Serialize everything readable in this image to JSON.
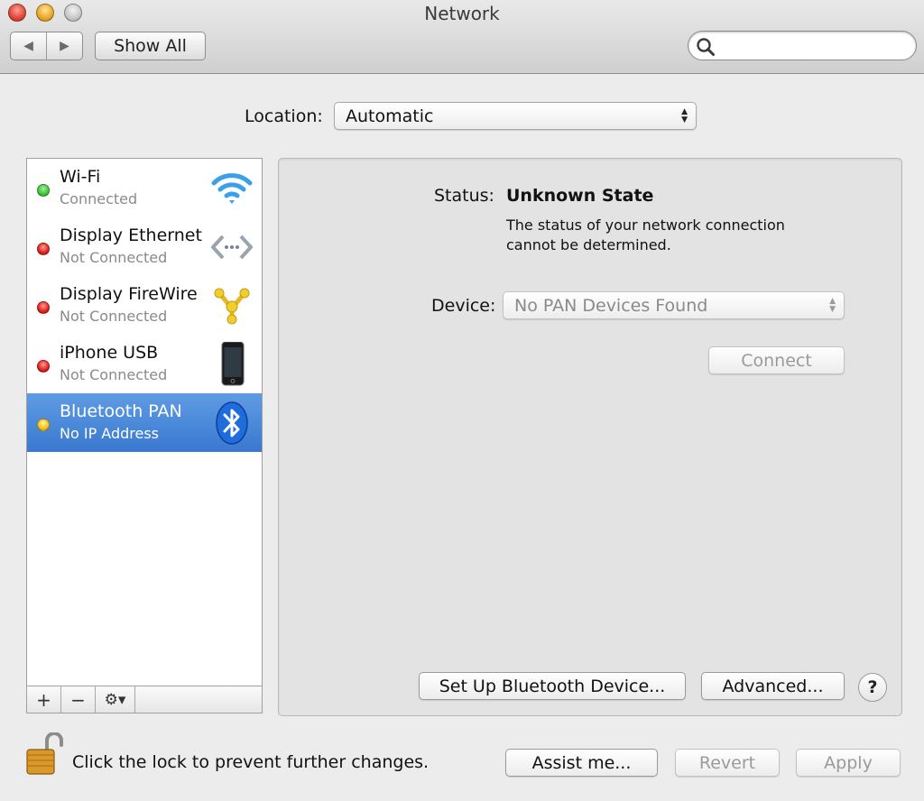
{
  "window": {
    "title": "Network"
  },
  "toolbar": {
    "back_glyph": "◀",
    "forward_glyph": "▶",
    "show_all_label": "Show All",
    "search_placeholder": "",
    "search_value": ""
  },
  "location": {
    "label": "Location:",
    "value": "Automatic"
  },
  "services": [
    {
      "name": "Wi-Fi",
      "status": "Connected",
      "status_color": "#3fc43a",
      "icon": "wifi-icon"
    },
    {
      "name": "Display Ethernet",
      "status": "Not Connected",
      "status_color": "#e0231c",
      "icon": "ethernet-icon"
    },
    {
      "name": "Display FireWire",
      "status": "Not Connected",
      "status_color": "#e0231c",
      "icon": "firewire-icon"
    },
    {
      "name": "iPhone USB",
      "status": "Not Connected",
      "status_color": "#e0231c",
      "icon": "iphone-icon"
    },
    {
      "name": "Bluetooth PAN",
      "status": "No IP Address",
      "status_color": "#f2c21b",
      "icon": "bluetooth-icon",
      "selected": true
    }
  ],
  "list_toolbar": {
    "add_label": "+",
    "remove_label": "−",
    "action_label": "⚙▾"
  },
  "detail": {
    "status_label": "Status:",
    "status_value": "Unknown State",
    "status_description": "The status of your network connection cannot be determined.",
    "device_label": "Device:",
    "device_value": "No PAN Devices Found",
    "connect_label": "Connect",
    "setup_label": "Set Up Bluetooth Device...",
    "advanced_label": "Advanced...",
    "help_label": "?"
  },
  "footer": {
    "lock_text": "Click the lock to prevent further changes.",
    "assist_label": "Assist me...",
    "revert_label": "Revert",
    "apply_label": "Apply"
  },
  "colors": {
    "selection": "#3a78d0",
    "background": "#ececec"
  }
}
